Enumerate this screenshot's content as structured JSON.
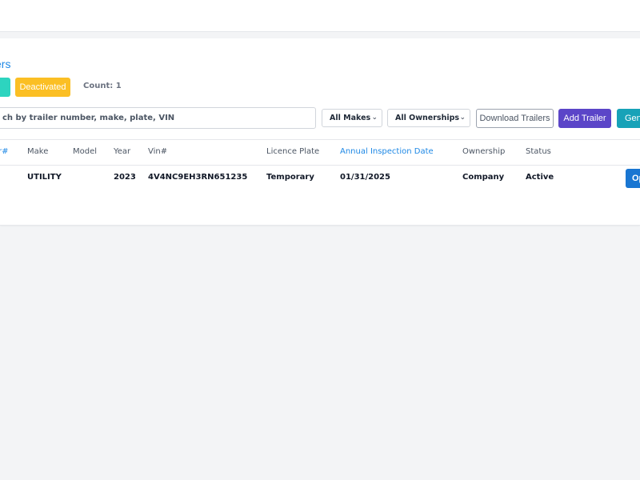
{
  "header": {
    "title": "ers"
  },
  "status_tabs": {
    "active_label": "e",
    "deactivated_label": "Deactivated",
    "count": "Count: 1"
  },
  "search": {
    "value": "ch by trailer number, make, plate, VIN"
  },
  "filters": {
    "makes_value": "All Makes",
    "ownership_value": "All Ownerships"
  },
  "actions": {
    "download_label": "Download Trailers",
    "add_label": "Add Trailer",
    "generate_label": "Gene"
  },
  "table": {
    "columns": [
      "r#",
      "Make",
      "Model",
      "Year",
      "Vin#",
      "Licence Plate",
      "Annual Inspection Date",
      "Ownership",
      "Status"
    ],
    "rows": [
      {
        "make": "UTILITY",
        "model": "",
        "year": "2023",
        "vin": "4V4NC9EH3RN651235",
        "plate": "Temporary",
        "inspection": "01/31/2025",
        "ownership": "Company",
        "status": "Active",
        "action": "Op"
      }
    ]
  },
  "colors": {
    "accent": "#1e88e5",
    "active_pill": "#2dd4bf",
    "deactivated_pill": "#fbbf24",
    "add_button": "#5b45c8",
    "generate_button": "#17a2b8",
    "row_button": "#1976d2"
  }
}
